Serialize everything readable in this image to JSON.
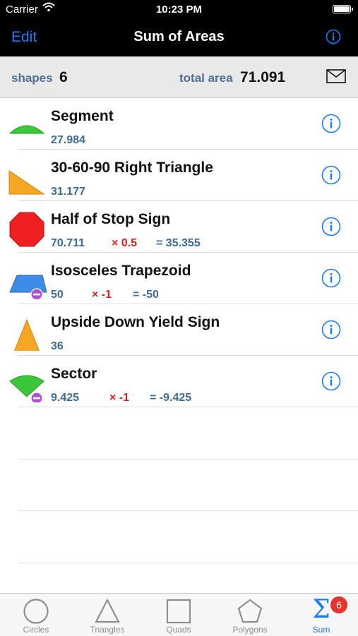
{
  "status": {
    "carrier": "Carrier",
    "time": "10:23 PM"
  },
  "nav": {
    "edit": "Edit",
    "title": "Sum of Areas"
  },
  "summary": {
    "shapes_label": "shapes",
    "shapes_count": "6",
    "total_label": "total area",
    "total_value": "71.091"
  },
  "rows": [
    {
      "title": "Segment",
      "area": "27.984",
      "mult": "",
      "result": "",
      "icon": "segment-shape-icon",
      "color": "#3ac73a"
    },
    {
      "title": "30-60-90 Right Triangle",
      "area": "31.177",
      "mult": "",
      "result": "",
      "icon": "right-triangle-shape-icon",
      "color": "#f5a623"
    },
    {
      "title": "Half of Stop Sign",
      "area": "70.711",
      "mult": "× 0.5",
      "result": "= 35.355",
      "icon": "octagon-shape-icon",
      "color": "#ee2020"
    },
    {
      "title": "Isosceles Trapezoid",
      "area": "50",
      "mult": "× -1",
      "result": "= -50",
      "icon": "trapezoid-shape-icon",
      "color": "#3d8de8"
    },
    {
      "title": "Upside Down Yield Sign",
      "area": "36",
      "mult": "",
      "result": "",
      "icon": "triangle-shape-icon",
      "color": "#f5a623"
    },
    {
      "title": "Sector",
      "area": "9.425",
      "mult": "× -1",
      "result": "= -9.425",
      "icon": "sector-shape-icon",
      "color": "#3ac73a"
    }
  ],
  "tabs": [
    {
      "label": "Circles",
      "icon": "circle-icon"
    },
    {
      "label": "Triangles",
      "icon": "triangle-icon"
    },
    {
      "label": "Quads",
      "icon": "square-icon"
    },
    {
      "label": "Polygons",
      "icon": "pentagon-icon"
    },
    {
      "label": "Sum",
      "icon": "sigma-icon"
    }
  ],
  "badge": "6",
  "colors": {
    "accent": "#1a7cf6",
    "value_blue": "#3d6b95",
    "multiplier_red": "#e02020",
    "badge_red": "#e5342d"
  }
}
